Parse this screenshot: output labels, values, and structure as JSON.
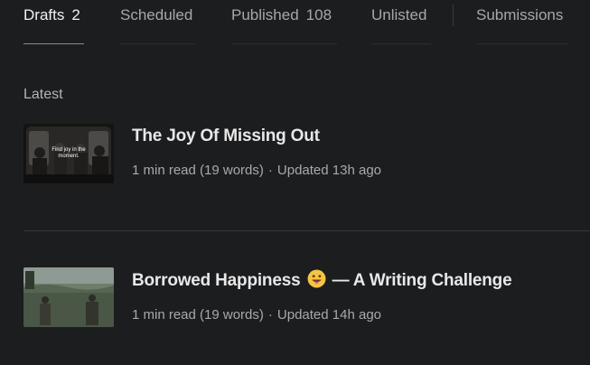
{
  "tabs": [
    {
      "label": "Drafts",
      "count": "2"
    },
    {
      "label": "Scheduled",
      "count": ""
    },
    {
      "label": "Published",
      "count": "108"
    },
    {
      "label": "Unlisted",
      "count": ""
    },
    {
      "label": "Submissions",
      "count": ""
    }
  ],
  "section": {
    "title": "Latest"
  },
  "stories": [
    {
      "title": "The Joy Of Missing Out",
      "read_time": "1 min read (19 words)",
      "separator": "·",
      "updated": "Updated 13h ago",
      "thumbnail_caption": "Find joy in the moment."
    },
    {
      "title_part1": "Borrowed Happiness",
      "title_part2": "— A Writing Challenge",
      "emoji": "grinning-face-with-tongue",
      "read_time": "1 min read (19 words)",
      "separator": "·",
      "updated": "Updated 14h ago"
    }
  ],
  "colors": {
    "background": "#1c1d1f",
    "active_tab_text": "#f2f2f2",
    "inactive_tab_text": "#a8a8a8",
    "active_tab_underline": "#8a8a8a"
  }
}
